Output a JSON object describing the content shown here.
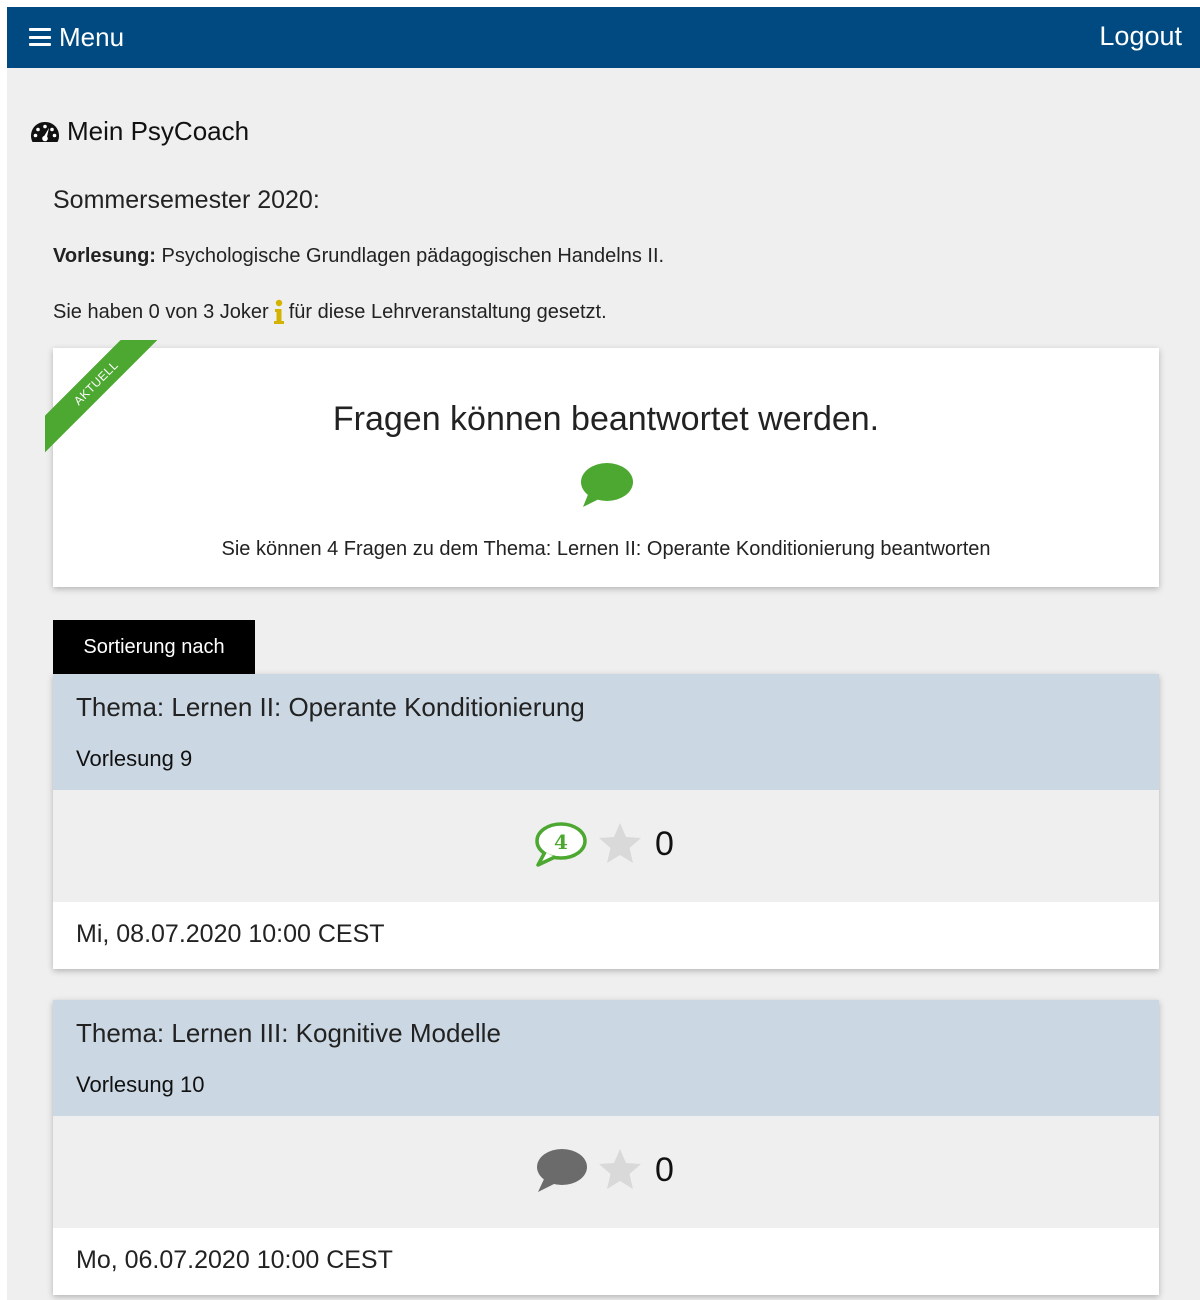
{
  "navbar": {
    "menu_label": "Menu",
    "logout_label": "Logout",
    "background": "#004a82"
  },
  "page": {
    "title": "Mein PsyCoach",
    "semester": "Sommersemester 2020:",
    "lecture_label": "Vorlesung:",
    "lecture_name": " Psychologische Grundlagen pädagogischen Handelns II.",
    "joker_before": "Sie haben 0 von 3 Joker",
    "joker_after": "für diese Lehrveranstaltung gesetzt."
  },
  "status_card": {
    "ribbon": "AKTUELL",
    "title": "Fragen können beantwortet werden.",
    "description": "Sie können 4 Fragen zu dem Thema: Lernen II: Operante Konditionierung beantworten",
    "accent": "#4ca830"
  },
  "sort": {
    "label": "Sortierung nach"
  },
  "lectures": [
    {
      "topic": "Thema: Lernen II: Operante Konditionierung",
      "number": "Vorlesung 9",
      "questions": "4",
      "question_icon": "speech-bubble-green-icon",
      "stars": "0",
      "date": "Mi, 08.07.2020 10:00 CEST"
    },
    {
      "topic": "Thema: Lernen III: Kognitive Modelle",
      "number": "Vorlesung 10",
      "questions": "",
      "question_icon": "speech-bubble-grey-icon",
      "stars": "0",
      "date": "Mo, 06.07.2020 10:00 CEST"
    }
  ]
}
